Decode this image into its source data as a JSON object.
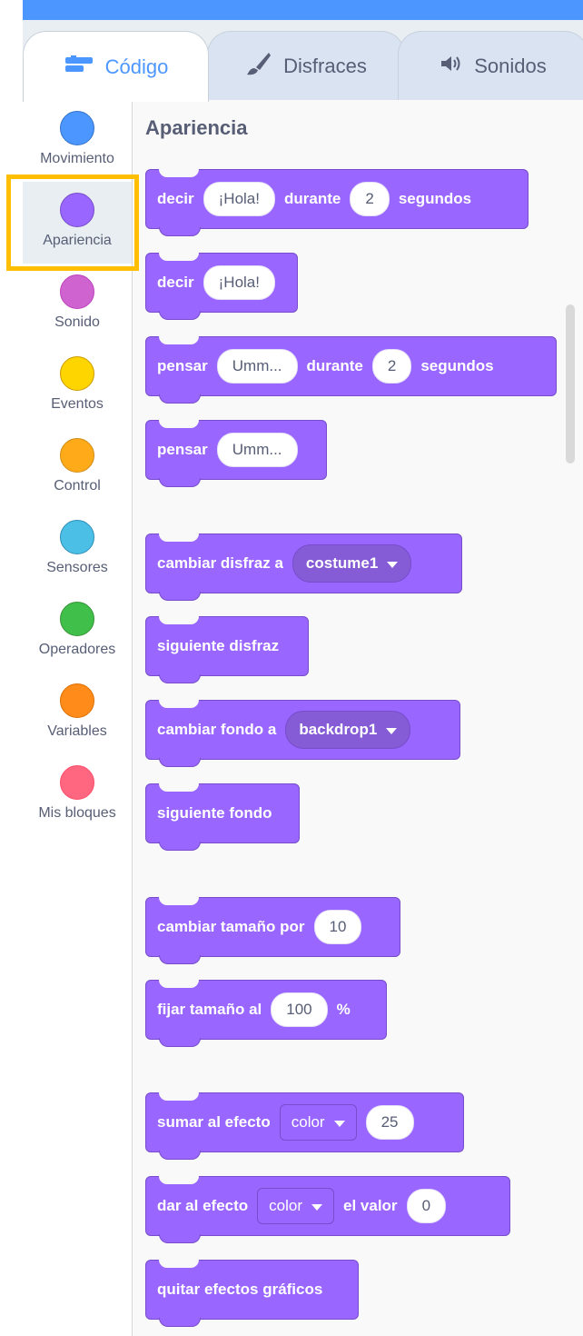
{
  "tabs": [
    {
      "label": "Código",
      "icon": "code-icon",
      "active": true
    },
    {
      "label": "Disfraces",
      "icon": "brush-icon",
      "active": false
    },
    {
      "label": "Sonidos",
      "icon": "speaker-icon",
      "active": false
    }
  ],
  "categories": [
    {
      "label": "Movimiento",
      "color": "#4c97ff"
    },
    {
      "label": "Apariencia",
      "color": "#9966ff",
      "selected": true
    },
    {
      "label": "Sonido",
      "color": "#cf63cf"
    },
    {
      "label": "Eventos",
      "color": "#ffd500"
    },
    {
      "label": "Control",
      "color": "#ffab19"
    },
    {
      "label": "Sensores",
      "color": "#4cbfe6"
    },
    {
      "label": "Operadores",
      "color": "#40bf4a"
    },
    {
      "label": "Variables",
      "color": "#ff8c1a"
    },
    {
      "label": "Mis bloques",
      "color": "#ff6680"
    }
  ],
  "palette": {
    "heading": "Apariencia",
    "blocks": {
      "say_for": {
        "t1": "decir",
        "v1": "¡Hola!",
        "t2": "durante",
        "v2": "2",
        "t3": "segundos"
      },
      "say": {
        "t1": "decir",
        "v1": "¡Hola!"
      },
      "think_for": {
        "t1": "pensar",
        "v1": "Umm...",
        "t2": "durante",
        "v2": "2",
        "t3": "segundos"
      },
      "think": {
        "t1": "pensar",
        "v1": "Umm..."
      },
      "switch_costume": {
        "t1": "cambiar disfraz a",
        "d1": "costume1"
      },
      "next_costume": {
        "t1": "siguiente disfraz"
      },
      "switch_backdrop": {
        "t1": "cambiar fondo a",
        "d1": "backdrop1"
      },
      "next_backdrop": {
        "t1": "siguiente fondo"
      },
      "change_size": {
        "t1": "cambiar tamaño por",
        "v1": "10"
      },
      "set_size": {
        "t1": "fijar tamaño al",
        "v1": "100",
        "t2": "%"
      },
      "change_effect": {
        "t1": "sumar al efecto",
        "d1": "color",
        "v1": "25"
      },
      "set_effect": {
        "t1": "dar al efecto",
        "d1": "color",
        "t2": "el valor",
        "v1": "0"
      },
      "clear_effects": {
        "t1": "quitar efectos gráficos"
      }
    }
  }
}
